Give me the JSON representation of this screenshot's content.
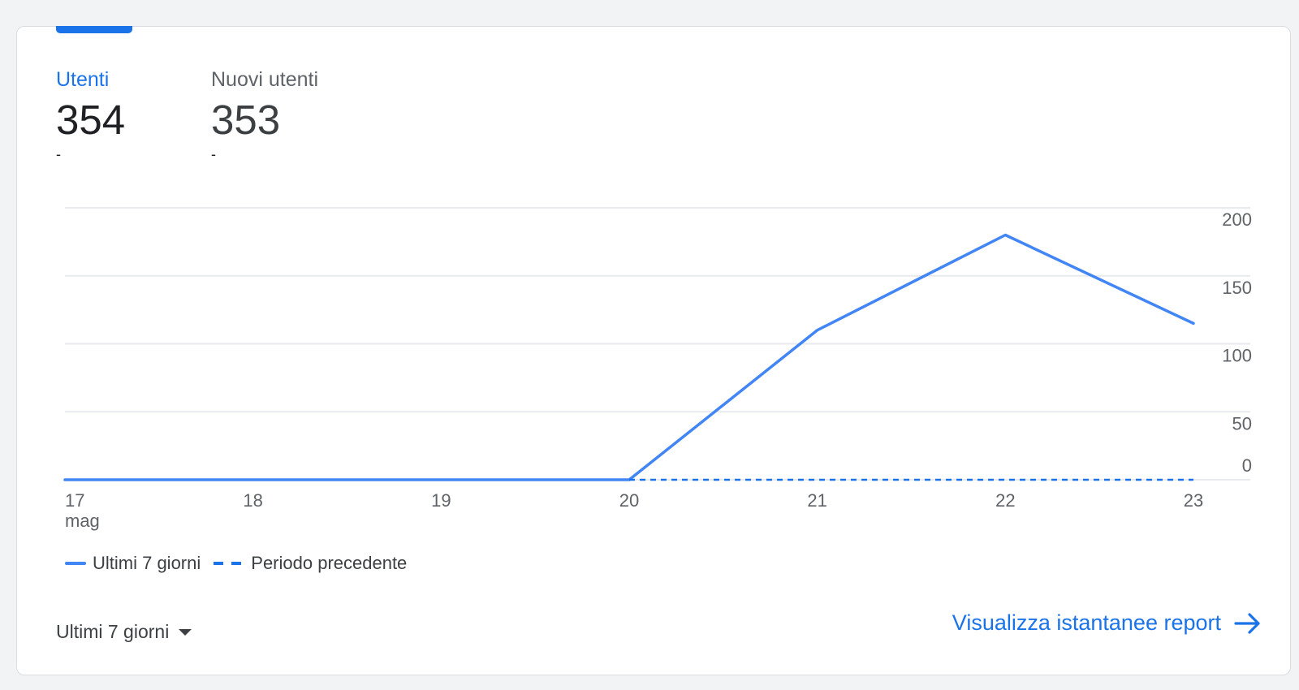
{
  "metrics": [
    {
      "label": "Utenti",
      "value": "354",
      "delta": "-"
    },
    {
      "label": "Nuovi utenti",
      "value": "353",
      "delta": "-"
    }
  ],
  "legend": {
    "current": "Ultimi 7 giorni",
    "previous": "Periodo precedente"
  },
  "footer": {
    "range_label": "Ultimi 7 giorni",
    "report_link": "Visualizza istantanee report"
  },
  "colors": {
    "accent": "#1a73e8",
    "series_line": "#4285f4",
    "grid": "#e8eaed",
    "text": "#3c4043"
  },
  "chart_data": {
    "type": "line",
    "x": [
      "17",
      "18",
      "19",
      "20",
      "21",
      "22",
      "23"
    ],
    "x_sublabel": "mag",
    "series": [
      {
        "name": "Ultimi 7 giorni",
        "values": [
          0,
          0,
          0,
          0,
          110,
          180,
          115
        ],
        "style": "solid"
      },
      {
        "name": "Periodo precedente",
        "values": [
          null,
          null,
          null,
          0,
          0,
          0,
          0
        ],
        "style": "dashed"
      }
    ],
    "y_ticks": [
      0,
      50,
      100,
      150,
      200
    ],
    "ylim": [
      0,
      200
    ],
    "grid": true,
    "y_axis_position": "right",
    "legend_position": "bottom-left"
  }
}
